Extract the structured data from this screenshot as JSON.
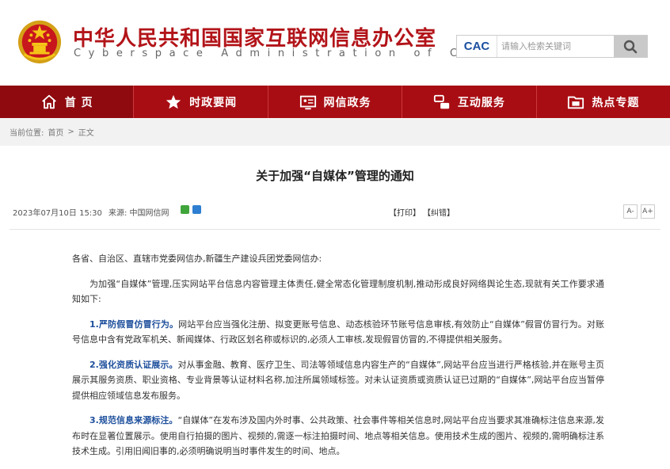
{
  "site": {
    "title_cn": "中华人民共和国国家互联网信息办公室",
    "title_en": "Cyberspace Administration of China",
    "logo_text": "CAC",
    "search_placeholder": "请输入检索关键词"
  },
  "nav": {
    "items": [
      {
        "label": "首 页",
        "icon": "home-icon"
      },
      {
        "label": "时政要闻",
        "icon": "star-icon"
      },
      {
        "label": "网信政务",
        "icon": "government-icon"
      },
      {
        "label": "互动服务",
        "icon": "interaction-icon"
      },
      {
        "label": "热点专题",
        "icon": "folder-icon"
      }
    ]
  },
  "breadcrumb": {
    "prefix": "当前位置:",
    "items": [
      "首页",
      "正文"
    ],
    "separator": ">"
  },
  "article": {
    "title": "关于加强“自媒体”管理的通知",
    "date": "2023年07月10日 15:30",
    "source": "来源: 中国网信网",
    "print": "【打印】",
    "error": "【纠错】",
    "font_down": "A-",
    "font_up": "A+",
    "salutation": "各省、自治区、直辖市党委网信办,新疆生产建设兵团党委网信办:",
    "intro": "为加强“自媒体”管理,压实网站平台信息内容管理主体责任,健全常态化管理制度机制,推动形成良好网络舆论生态,现就有关工作要求通知如下:",
    "sections": [
      {
        "heading": "1.严防假冒仿冒行为。",
        "text": "网站平台应当强化注册、拟变更账号信息、动态核验环节账号信息审核,有效防止“自媒体”假冒仿冒行为。对账号信息中含有党政军机关、新闻媒体、行政区划名称或标识的,必须人工审核,发现假冒仿冒的,不得提供相关服务。"
      },
      {
        "heading": "2.强化资质认证展示。",
        "text": "对从事金融、教育、医疗卫生、司法等领域信息内容生产的“自媒体”,网站平台应当进行严格核验,并在账号主页展示其服务资质、职业资格、专业背景等认证材料名称,加注所属领域标签。对未认证资质或资质认证已过期的“自媒体”,网站平台应当暂停提供相应领域信息发布服务。"
      },
      {
        "heading": "3.规范信息来源标注。",
        "text": "“自媒体”在发布涉及国内外时事、公共政策、社会事件等相关信息时,网站平台应当要求其准确标注信息来源,发布时在显著位置展示。使用自行拍摄的图片、视频的,需逐一标注拍摄时间、地点等相关信息。使用技术生成的图片、视频的,需明确标注系技术生成。引用旧闻旧事的,必须明确说明当时事件发生的时间、地点。"
      }
    ]
  }
}
